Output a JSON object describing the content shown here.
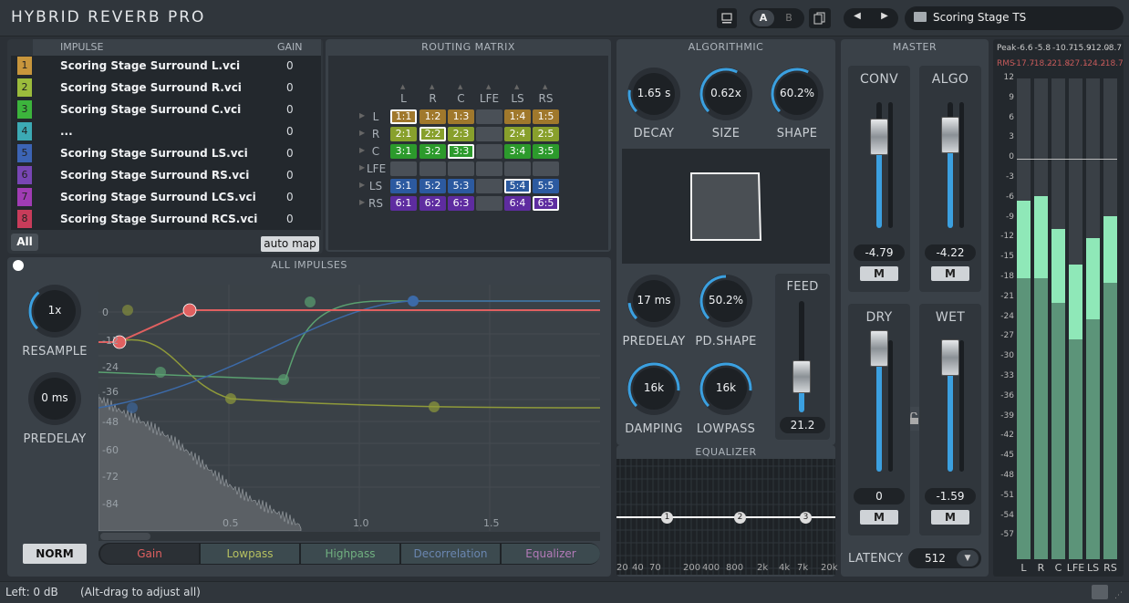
{
  "app": {
    "title": "HYBRID REVERB PRO",
    "ab": [
      "A",
      "B"
    ],
    "preset": "Scoring Stage TS"
  },
  "impulse": {
    "header": "IMPULSE",
    "gain_header": "GAIN",
    "all": "All",
    "auto_map": "auto map",
    "rows": [
      {
        "num": "1",
        "name": "Scoring Stage Surround L.vci",
        "gain": "0",
        "color": "#c8963c"
      },
      {
        "num": "2",
        "name": "Scoring Stage Surround R.vci",
        "gain": "0",
        "color": "#9bbb3c"
      },
      {
        "num": "3",
        "name": "Scoring Stage Surround C.vci",
        "gain": "0",
        "color": "#3cb43c"
      },
      {
        "num": "4",
        "name": "...",
        "gain": "0",
        "color": "#3caab4"
      },
      {
        "num": "5",
        "name": "Scoring Stage Surround LS.vci",
        "gain": "0",
        "color": "#3c64b4"
      },
      {
        "num": "6",
        "name": "Scoring Stage Surround RS.vci",
        "gain": "0",
        "color": "#7846b4"
      },
      {
        "num": "7",
        "name": "Scoring Stage Surround LCS.vci",
        "gain": "0",
        "color": "#a03cb4"
      },
      {
        "num": "8",
        "name": "Scoring Stage Surround RCS.vci",
        "gain": "0",
        "color": "#c83c5a"
      }
    ]
  },
  "routing": {
    "header": "ROUTING MATRIX",
    "cols": [
      "L",
      "R",
      "C",
      "LFE",
      "LS",
      "RS"
    ],
    "rows": [
      "L",
      "R",
      "C",
      "LFE",
      "LS",
      "RS"
    ],
    "cells": [
      [
        "1:1",
        "1:2",
        "1:3",
        "",
        "1:4",
        "1:5"
      ],
      [
        "2:1",
        "2:2",
        "2:3",
        "",
        "2:4",
        "2:5"
      ],
      [
        "3:1",
        "3:2",
        "3:3",
        "",
        "3:4",
        "3:5"
      ],
      [
        "",
        "",
        "",
        "",
        "",
        ""
      ],
      [
        "5:1",
        "5:2",
        "5:3",
        "",
        "5:4",
        "5:5"
      ],
      [
        "6:1",
        "6:2",
        "6:3",
        "",
        "6:4",
        "6:5"
      ]
    ]
  },
  "algorithmic": {
    "header": "ALGORITHMIC",
    "decay": {
      "value": "1.65 s",
      "label": "DECAY"
    },
    "size": {
      "value": "0.62x",
      "label": "SIZE"
    },
    "shape": {
      "value": "60.2%",
      "label": "SHAPE"
    },
    "predelay": {
      "value": "17 ms",
      "label": "PREDELAY"
    },
    "pdshape": {
      "value": "50.2%",
      "label": "PD.SHAPE"
    },
    "damping": {
      "value": "16k",
      "label": "DAMPING"
    },
    "lowpass": {
      "value": "16k",
      "label": "LOWPASS"
    },
    "feed": {
      "label": "FEED",
      "value": "21.2"
    }
  },
  "equalizer": {
    "header": "EQUALIZER",
    "points": [
      "1",
      "2",
      "3"
    ],
    "freqs": [
      "20",
      "40",
      "70",
      "200",
      "400",
      "800",
      "2k",
      "4k",
      "7k",
      "20k"
    ]
  },
  "master": {
    "header": "MASTER",
    "conv": {
      "label": "CONV",
      "value": "-4.79",
      "m": "M"
    },
    "algo": {
      "label": "ALGO",
      "value": "-4.22",
      "m": "M"
    },
    "dry": {
      "label": "DRY",
      "value": "0",
      "m": "M"
    },
    "wet": {
      "label": "WET",
      "value": "-1.59",
      "m": "M"
    },
    "latency_label": "LATENCY",
    "latency": "512"
  },
  "meter": {
    "peak_label": "Peak",
    "peak": [
      "-6.6",
      "-5.8",
      "-10.7",
      "-15.9",
      "-12.0",
      "-8.7"
    ],
    "rms_label": "RMS",
    "rms": [
      "-17.7",
      "-18.2",
      "-21.8",
      "-27.1",
      "-24.2",
      "-18.7"
    ],
    "scale": [
      "12",
      "9",
      "6",
      "3",
      "0",
      "-3",
      "-6",
      "-9",
      "-12",
      "-15",
      "-18",
      "-21",
      "-24",
      "-27",
      "-30",
      "-33",
      "-36",
      "-39",
      "-42",
      "-45",
      "-48",
      "-51",
      "-54",
      "-57"
    ],
    "channels": [
      "L",
      "R",
      "C",
      "LFE",
      "LS",
      "RS"
    ]
  },
  "all_impulses": {
    "header": "ALL IMPULSES",
    "resample": {
      "value": "1x",
      "label": "RESAMPLE"
    },
    "predelay": {
      "value": "0 ms",
      "label": "PREDELAY"
    },
    "norm": "NORM",
    "db_labels": [
      "0",
      "-12",
      "-24",
      "-36",
      "-48",
      "-60",
      "-72",
      "-84"
    ],
    "time_labels": [
      "0.5",
      "1.0",
      "1.5"
    ],
    "tabs": [
      "Gain",
      "Lowpass",
      "Highpass",
      "Decorrelation",
      "Equalizer"
    ]
  },
  "status": {
    "left": "Left: 0 dB",
    "hint": "(Alt-drag to adjust all)"
  }
}
